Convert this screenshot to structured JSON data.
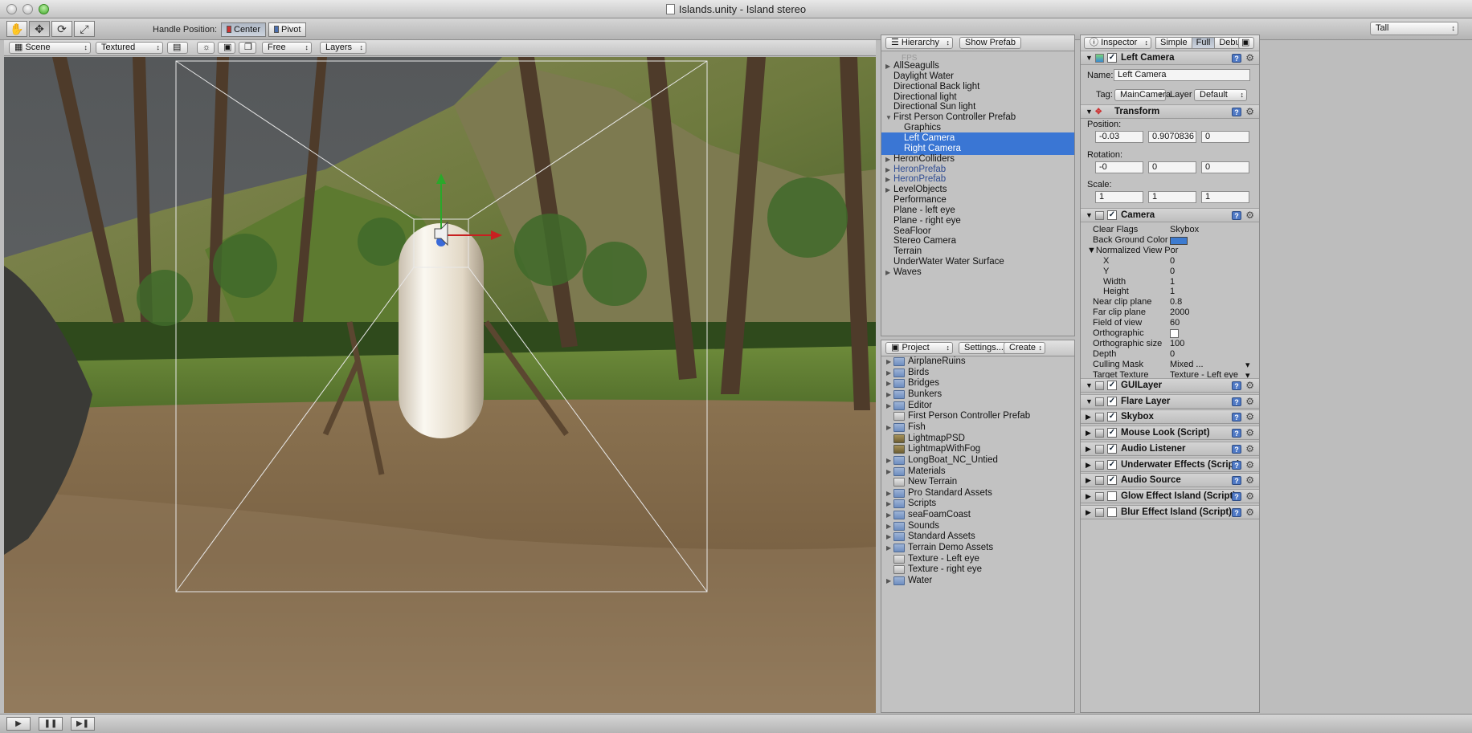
{
  "window": {
    "title": "Islands.unity - Island stereo"
  },
  "toolbar": {
    "handle_position_label": "Handle Position:",
    "center_label": "Center",
    "pivot_label": "Pivot",
    "layout_value": "Tall",
    "tools": [
      "hand-icon",
      "move-icon",
      "rotate-icon",
      "scale-icon"
    ]
  },
  "scene": {
    "view_value": "Scene",
    "render_mode_value": "Textured",
    "camera_mode_value": "Free",
    "layers_label": "Layers"
  },
  "hierarchy": {
    "title": "Hierarchy",
    "show_prefab_label": "Show Prefab",
    "ghost_label": "FPS",
    "items": [
      {
        "label": "AllSeagulls",
        "expand": "collapsed",
        "indent": 0,
        "style": "normal"
      },
      {
        "label": "Daylight Water",
        "expand": "none",
        "indent": 0,
        "style": "normal"
      },
      {
        "label": "Directional Back light",
        "expand": "none",
        "indent": 0,
        "style": "normal"
      },
      {
        "label": "Directional light",
        "expand": "none",
        "indent": 0,
        "style": "normal"
      },
      {
        "label": "Directional Sun light",
        "expand": "none",
        "indent": 0,
        "style": "normal"
      },
      {
        "label": "First Person Controller Prefab",
        "expand": "expanded",
        "indent": 0,
        "style": "normal"
      },
      {
        "label": "Graphics",
        "expand": "none",
        "indent": 1,
        "style": "normal"
      },
      {
        "label": "Left Camera",
        "expand": "none",
        "indent": 1,
        "style": "selected"
      },
      {
        "label": "Right Camera",
        "expand": "none",
        "indent": 1,
        "style": "selected"
      },
      {
        "label": "HeronColliders",
        "expand": "collapsed",
        "indent": 0,
        "style": "normal"
      },
      {
        "label": "HeronPrefab",
        "expand": "collapsed",
        "indent": 0,
        "style": "prefab"
      },
      {
        "label": "HeronPrefab",
        "expand": "collapsed",
        "indent": 0,
        "style": "prefab"
      },
      {
        "label": "LevelObjects",
        "expand": "collapsed",
        "indent": 0,
        "style": "normal"
      },
      {
        "label": "Performance",
        "expand": "none",
        "indent": 0,
        "style": "normal"
      },
      {
        "label": "Plane - left eye",
        "expand": "none",
        "indent": 0,
        "style": "normal"
      },
      {
        "label": "Plane - right eye",
        "expand": "none",
        "indent": 0,
        "style": "normal"
      },
      {
        "label": "SeaFloor",
        "expand": "none",
        "indent": 0,
        "style": "normal"
      },
      {
        "label": "Stereo Camera",
        "expand": "none",
        "indent": 0,
        "style": "normal"
      },
      {
        "label": "Terrain",
        "expand": "none",
        "indent": 0,
        "style": "normal"
      },
      {
        "label": "UnderWater Water Surface",
        "expand": "none",
        "indent": 0,
        "style": "normal"
      },
      {
        "label": "Waves",
        "expand": "collapsed",
        "indent": 0,
        "style": "normal"
      }
    ]
  },
  "project": {
    "title": "Project",
    "settings_label": "Settings...",
    "create_label": "Create",
    "items": [
      {
        "label": "AirplaneRuins",
        "icon": "folder"
      },
      {
        "label": "Birds",
        "icon": "folder"
      },
      {
        "label": "Bridges",
        "icon": "folder"
      },
      {
        "label": "Bunkers",
        "icon": "folder"
      },
      {
        "label": "Editor",
        "icon": "folder"
      },
      {
        "label": "First Person Controller Prefab",
        "icon": "prefab"
      },
      {
        "label": "Fish",
        "icon": "folder"
      },
      {
        "label": "LightmapPSD",
        "icon": "texture"
      },
      {
        "label": "LightmapWithFog",
        "icon": "texture"
      },
      {
        "label": "LongBoat_NC_Untied",
        "icon": "folder"
      },
      {
        "label": "Materials",
        "icon": "folder"
      },
      {
        "label": "New Terrain",
        "icon": "terrain"
      },
      {
        "label": "Pro Standard Assets",
        "icon": "folder"
      },
      {
        "label": "Scripts",
        "icon": "folder"
      },
      {
        "label": "seaFoamCoast",
        "icon": "folder"
      },
      {
        "label": "Sounds",
        "icon": "folder"
      },
      {
        "label": "Standard Assets",
        "icon": "folder"
      },
      {
        "label": "Terrain Demo Assets",
        "icon": "folder"
      },
      {
        "label": "Texture - Left eye",
        "icon": "render-texture"
      },
      {
        "label": "Texture - right eye",
        "icon": "render-texture"
      },
      {
        "label": "Water",
        "icon": "folder"
      }
    ]
  },
  "inspector": {
    "title": "Inspector",
    "modes": [
      "Simple",
      "Full",
      "Debug"
    ],
    "active_mode": "Full",
    "object_name": "Left Camera",
    "name_label": "Name:",
    "name_value": "Left Camera",
    "tag_label": "Tag:",
    "tag_value": "MainCamera",
    "layer_label": "Layer",
    "layer_value": "Default",
    "transform": {
      "title": "Transform",
      "position_label": "Position:",
      "position": [
        "-0.03",
        "0.9070836",
        "0"
      ],
      "rotation_label": "Rotation:",
      "rotation": [
        "-0",
        "0",
        "0"
      ],
      "scale_label": "Scale:",
      "scale": [
        "1",
        "1",
        "1"
      ]
    },
    "camera": {
      "title": "Camera",
      "props": [
        {
          "label": "Clear Flags",
          "value": "Skybox",
          "indent": 0
        },
        {
          "label": "Back Ground Color",
          "value": "",
          "indent": 0,
          "color": "#3d7bd0"
        },
        {
          "label": "Normalized View Por",
          "value": "",
          "indent": 0,
          "fold": true
        },
        {
          "label": "X",
          "value": "0",
          "indent": 1
        },
        {
          "label": "Y",
          "value": "0",
          "indent": 1
        },
        {
          "label": "Width",
          "value": "1",
          "indent": 1
        },
        {
          "label": "Height",
          "value": "1",
          "indent": 1
        },
        {
          "label": "Near clip plane",
          "value": "0.8",
          "indent": 0
        },
        {
          "label": "Far clip plane",
          "value": "2000",
          "indent": 0
        },
        {
          "label": "Field of view",
          "value": "60",
          "indent": 0
        },
        {
          "label": "Orthographic",
          "value": "",
          "indent": 0,
          "checkbox": true
        },
        {
          "label": "Orthographic size",
          "value": "100",
          "indent": 0
        },
        {
          "label": "Depth",
          "value": "0",
          "indent": 0
        },
        {
          "label": "Culling Mask",
          "value": "Mixed ...",
          "indent": 0,
          "dropdown": true
        },
        {
          "label": "Target Texture",
          "value": "Texture - Left eye",
          "indent": 0,
          "dropdown": true
        }
      ]
    },
    "components": [
      {
        "name": "GUILayer",
        "expanded": true,
        "checked": true
      },
      {
        "name": "Flare Layer",
        "expanded": true,
        "checked": true
      },
      {
        "name": "Skybox",
        "expanded": false,
        "checked": true
      },
      {
        "name": "Mouse Look (Script)",
        "expanded": false,
        "checked": true
      },
      {
        "name": "Audio Listener",
        "expanded": false,
        "checked": true
      },
      {
        "name": "Underwater Effects (Script)",
        "expanded": false,
        "checked": true
      },
      {
        "name": "Audio Source",
        "expanded": false,
        "checked": true
      },
      {
        "name": "Glow Effect Island (Script)",
        "expanded": false,
        "checked": false
      },
      {
        "name": "Blur Effect Island (Script)",
        "expanded": false,
        "checked": false
      }
    ]
  },
  "playback": {
    "controls": [
      "play-icon",
      "pause-icon",
      "step-icon"
    ]
  },
  "colors": {
    "selection": "#3a76d4",
    "prefab_text": "#2f4c92",
    "panel_bg": "#c2c2c2"
  }
}
